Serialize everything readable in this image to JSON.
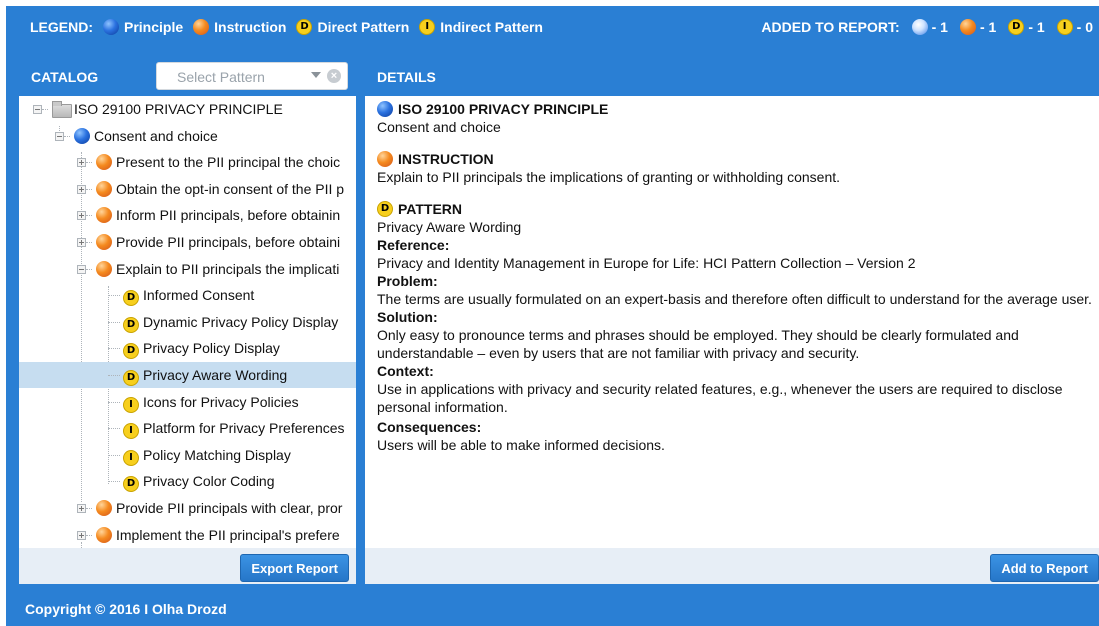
{
  "legend": {
    "title": "LEGEND:",
    "items": [
      {
        "icon": "principle-icon",
        "label": "Principle"
      },
      {
        "icon": "instruction-icon",
        "label": "Instruction"
      },
      {
        "icon": "direct-pattern-icon",
        "letter": "D",
        "label": "Direct Pattern"
      },
      {
        "icon": "indirect-pattern-icon",
        "letter": "I",
        "label": "Indirect Pattern"
      }
    ],
    "report_title": "ADDED TO REPORT:",
    "counts": [
      {
        "icon": "principle-icon",
        "value": "- 1"
      },
      {
        "icon": "instruction-icon",
        "value": "- 1"
      },
      {
        "icon": "direct-pattern-icon",
        "letter": "D",
        "value": "- 1"
      },
      {
        "icon": "indirect-pattern-icon",
        "letter": "I",
        "value": "- 0"
      }
    ]
  },
  "catalog": {
    "title": "CATALOG",
    "select_placeholder": "Select Pattern",
    "export_label": "Export Report",
    "tree": [
      {
        "label": "ISO 29100 PRIVACY PRINCIPLE",
        "icon": "folder-icon",
        "level": 0,
        "toggle": "minus"
      },
      {
        "label": "Consent and choice",
        "icon": "principle-icon",
        "level": 1,
        "toggle": "minus"
      },
      {
        "label": "Present to the PII principal the choic",
        "icon": "instruction-icon",
        "level": 2,
        "toggle": "plus"
      },
      {
        "label": "Obtain the opt-in consent of the PII p",
        "icon": "instruction-icon",
        "level": 2,
        "toggle": "plus"
      },
      {
        "label": "Inform PII principals, before obtainin",
        "icon": "instruction-icon",
        "level": 2,
        "toggle": "plus"
      },
      {
        "label": "Provide PII principals, before obtaini",
        "icon": "instruction-icon",
        "level": 2,
        "toggle": "plus"
      },
      {
        "label": "Explain to PII principals the implicati",
        "icon": "instruction-icon",
        "level": 2,
        "toggle": "minus"
      },
      {
        "label": "Informed Consent",
        "icon": "direct-pattern-icon",
        "letter": "D",
        "level": 3
      },
      {
        "label": "Dynamic Privacy Policy Display",
        "icon": "direct-pattern-icon",
        "letter": "D",
        "level": 3
      },
      {
        "label": "Privacy Policy Display",
        "icon": "direct-pattern-icon",
        "letter": "D",
        "level": 3
      },
      {
        "label": "Privacy Aware Wording",
        "icon": "direct-pattern-icon",
        "letter": "D",
        "level": 3,
        "selected": true
      },
      {
        "label": "Icons for Privacy Policies",
        "icon": "indirect-pattern-icon",
        "letter": "I",
        "level": 3
      },
      {
        "label": "Platform for Privacy Preferences",
        "icon": "indirect-pattern-icon",
        "letter": "I",
        "level": 3
      },
      {
        "label": "Policy Matching Display",
        "icon": "indirect-pattern-icon",
        "letter": "I",
        "level": 3
      },
      {
        "label": "Privacy Color Coding",
        "icon": "direct-pattern-icon",
        "letter": "D",
        "level": 3
      },
      {
        "label": "Provide PII principals with clear, pror",
        "icon": "instruction-icon",
        "level": 2,
        "toggle": "plus"
      },
      {
        "label": "Implement the PII principal's prefere",
        "icon": "instruction-icon",
        "level": 2,
        "toggle": "plus"
      }
    ]
  },
  "details": {
    "title": "DETAILS",
    "principle_heading": "ISO 29100 PRIVACY PRINCIPLE",
    "principle_text": "Consent and choice",
    "instruction_heading": "INSTRUCTION",
    "instruction_text": "Explain to PII principals the implications of granting or withholding consent.",
    "pattern_heading": "PATTERN",
    "pattern_letter": "D",
    "pattern_name": "Privacy Aware Wording",
    "reference_label": "Reference:",
    "reference_text": "Privacy and Identity Management in Europe for Life: HCI Pattern Collection – Version 2",
    "problem_label": "Problem:",
    "problem_text": "The terms are usually formulated on an expert-basis and therefore often difficult to understand for the average user.",
    "solution_label": "Solution:",
    "solution_text": "Only easy to pronounce terms and phrases should be employed. They should be clearly formulated and understandable – even by users that are not familiar with privacy and security.",
    "context_label": "Context:",
    "context_text": "Use in applications with privacy and security related features, e.g., whenever the users are required to disclose personal information.",
    "consequences_label": "Consequences:",
    "consequences_text": "Users will be able to make informed decisions.",
    "add_label": "Add to Report"
  },
  "footer": {
    "copyright": "Copyright © 2016 I Olha Drozd"
  }
}
